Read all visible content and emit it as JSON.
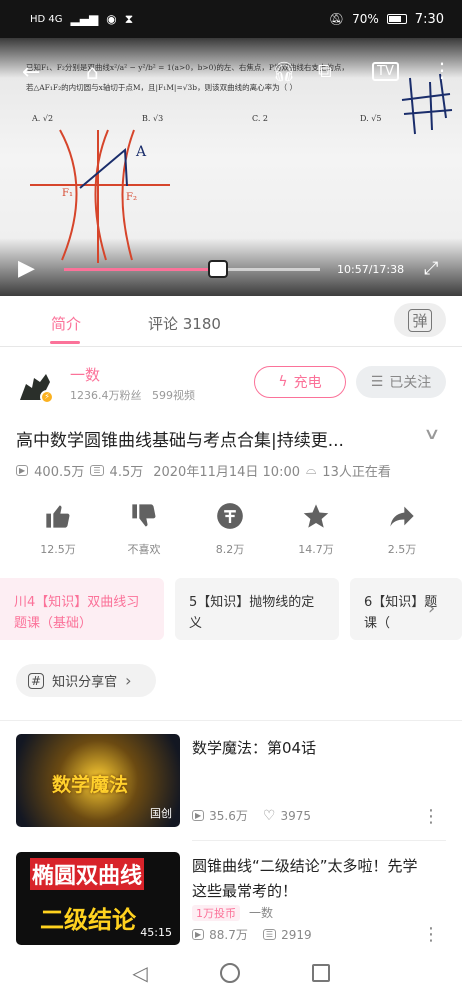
{
  "status_bar": {
    "left_text": "HD 4G",
    "battery": "70%",
    "time": "7:30"
  },
  "video": {
    "problem_line1": "已知F₁、F₂分别是双曲线x²/a² − y²/b² = 1(a>0，b>0)的左、右焦点，P为双曲线右支上的点，",
    "problem_line2": "若△AF₁F₂的内切圆与x轴切于点M，且|F₁M|=√3b，则该双曲线的离心率为（ ）",
    "options": [
      "A. √2",
      "B. √3",
      "C. 2",
      "D. √5"
    ],
    "sketch_labels": [
      "A",
      "F₁",
      "F₂"
    ],
    "current_time": "10:57",
    "total_time": "17:38",
    "progress": 0.6
  },
  "tabs": [
    {
      "label": "简介",
      "active": true
    },
    {
      "label": "评论 3180",
      "active": false
    }
  ],
  "danmaku_toggle": "弹",
  "author": {
    "name": "一数",
    "fans": "1236.4万粉丝",
    "videos": "599视频"
  },
  "buttons": {
    "charge": "充电",
    "followed": "已关注"
  },
  "video_title": "高中数学圆锥曲线基础与考点合集|持续更...",
  "stats": {
    "plays": "400.5万",
    "danmaku": "4.5万",
    "date": "2020年11月14日 10:00",
    "watching": "13人正在看"
  },
  "actions": [
    {
      "icon": "like-icon",
      "label": "12.5万"
    },
    {
      "icon": "dislike-icon",
      "label": "不喜欢"
    },
    {
      "icon": "coin-icon",
      "label": "8.2万"
    },
    {
      "icon": "favorite-icon",
      "label": "14.7万"
    },
    {
      "icon": "share-icon",
      "label": "2.5万"
    }
  ],
  "episodes": [
    {
      "text": "川4【知识】双曲线习题课（基础）",
      "active": true
    },
    {
      "text": "5【知识】抛物线的定义",
      "active": false
    },
    {
      "text": "6【知识】题课（",
      "active": false
    }
  ],
  "tag": "知识分享官",
  "recommendations": [
    {
      "title": "数学魔法：第04话",
      "thumb_text": "数学魔法",
      "thumb_tag": "国创",
      "plays": "35.6万",
      "likes": "3975"
    },
    {
      "title": "圆锥曲线“二级结论”太多啦！先学这些最常考的！",
      "thumb_text_1": "椭圆双曲线",
      "thumb_text_2": "二级结论",
      "duration": "45:15",
      "badge": "1万投币",
      "up": "一数",
      "plays": "88.7万",
      "danmaku": "2919"
    }
  ],
  "colors": {
    "accent": "#fb7299",
    "video_sketch_red": "#d6452b",
    "video_sketch_blue": "#1a2d6b"
  }
}
